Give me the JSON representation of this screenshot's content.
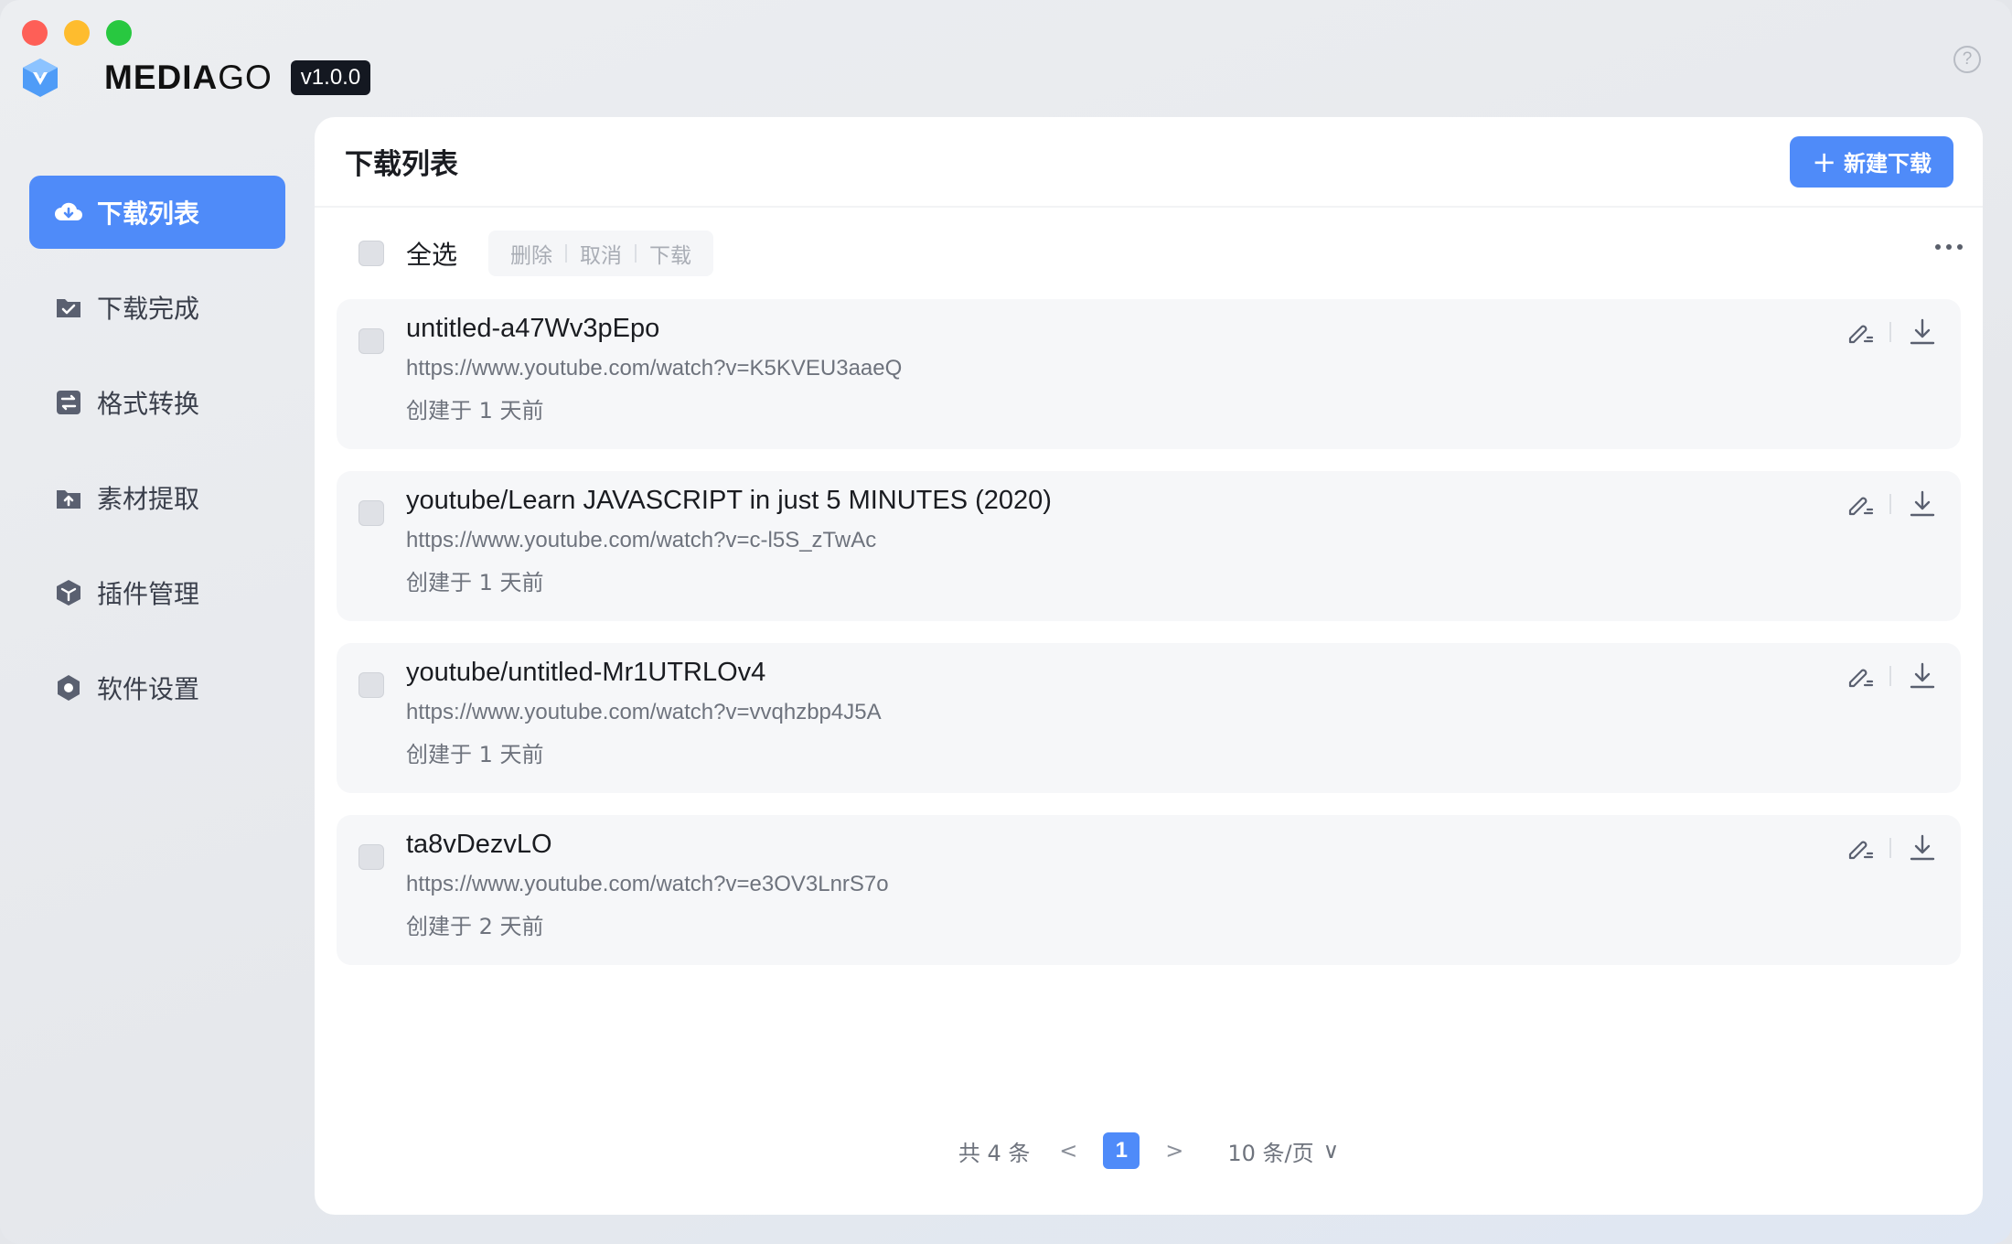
{
  "app": {
    "name_bold": "MEDIA",
    "name_thin": "GO",
    "version": "v1.0.0",
    "help_glyph": "?"
  },
  "sidebar": {
    "items": [
      {
        "label": "下载列表",
        "icon": "cloud-download-icon",
        "active": true
      },
      {
        "label": "下载完成",
        "icon": "folder-check-icon",
        "active": false
      },
      {
        "label": "格式转换",
        "icon": "convert-icon",
        "active": false
      },
      {
        "label": "素材提取",
        "icon": "extract-icon",
        "active": false
      },
      {
        "label": "插件管理",
        "icon": "plugin-cube-icon",
        "active": false
      },
      {
        "label": "软件设置",
        "icon": "gear-icon",
        "active": false
      }
    ]
  },
  "main": {
    "title": "下载列表",
    "new_button": {
      "plus": "+",
      "label": "新建下载"
    },
    "toolbar": {
      "select_all": "全选",
      "delete": "删除",
      "cancel": "取消",
      "download": "下载"
    },
    "items": [
      {
        "title": "untitled-a47Wv3pEpo",
        "url": "https://www.youtube.com/watch?v=K5KVEU3aaeQ",
        "created": "创建于 1 天前"
      },
      {
        "title": "youtube/Learn JAVASCRIPT in just 5 MINUTES (2020)",
        "url": "https://www.youtube.com/watch?v=c-l5S_zTwAc",
        "created": "创建于 1 天前"
      },
      {
        "title": "youtube/untitled-Mr1UTRLOv4",
        "url": "https://www.youtube.com/watch?v=vvqhzbp4J5A",
        "created": "创建于 1 天前"
      },
      {
        "title": "ta8vDezvLO",
        "url": "https://www.youtube.com/watch?v=e3OV3LnrS7o",
        "created": "创建于 2 天前"
      }
    ],
    "pagination": {
      "total": "共 4 条",
      "prev": "<",
      "current": "1",
      "next": ">",
      "page_size": "10 条/页",
      "size_chevron": "∨"
    }
  },
  "colors": {
    "accent": "#4f8bf9",
    "traffic_red": "#fe5f57",
    "traffic_yellow": "#febc2e",
    "traffic_green": "#28c840"
  }
}
